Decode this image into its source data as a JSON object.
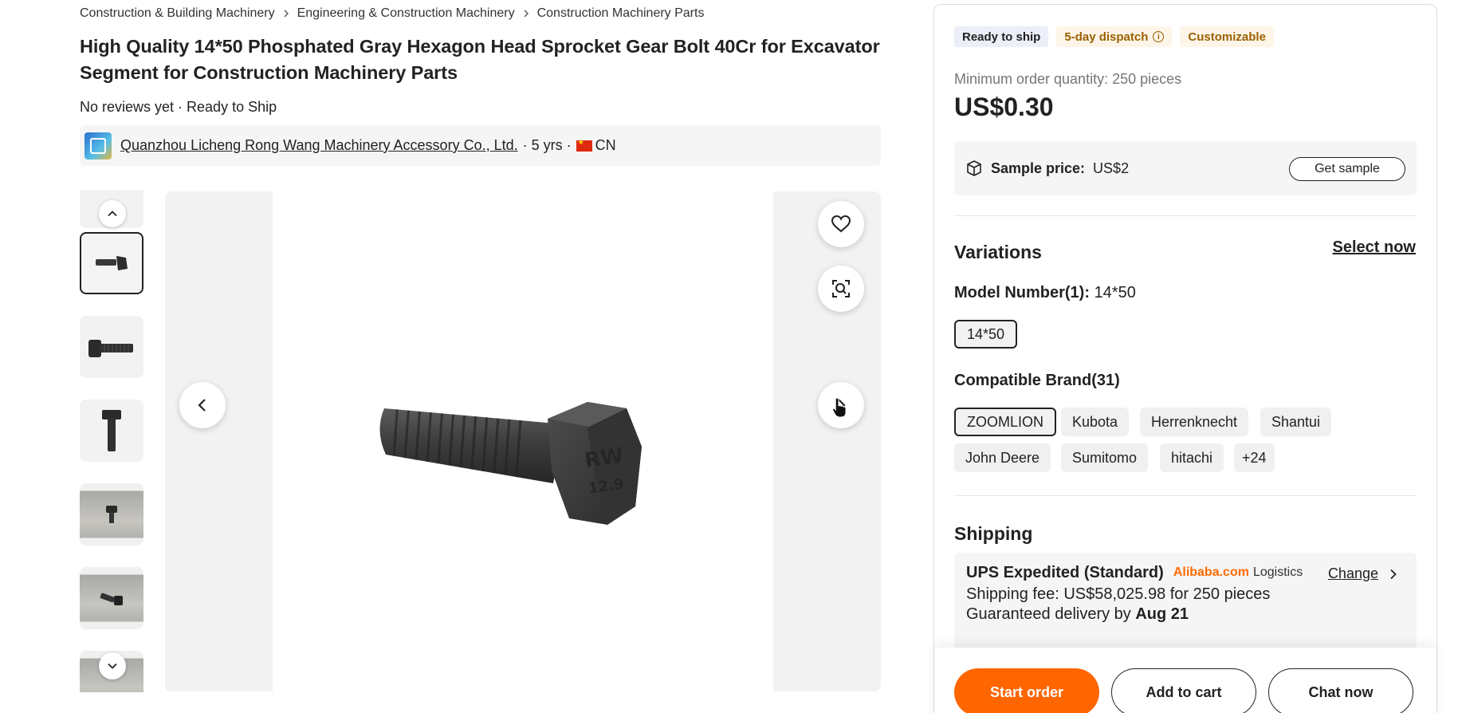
{
  "breadcrumb": [
    "Construction & Building Machinery",
    "Engineering & Construction Machinery",
    "Construction Machinery Parts"
  ],
  "product": {
    "title": "High Quality 14*50 Phosphated Gray Hexagon Head Sprocket Gear Bolt 40Cr for Excavator Segment for Construction Machinery Parts",
    "reviews_status": "No reviews yet · Ready to Ship"
  },
  "supplier": {
    "name": "Quanzhou Licheng Rong Wang Machinery Accessory Co., Ltd.",
    "years": "· 5 yrs ·",
    "country": "CN"
  },
  "gallery": {
    "thumbnail_count": 7,
    "active_index": 1
  },
  "badges": {
    "ready": "Ready to ship",
    "dispatch": "5-day dispatch",
    "dispatch_info": "i",
    "custom": "Customizable"
  },
  "pricing": {
    "moq": "Minimum order quantity: 250 pieces",
    "price": "US$0.30",
    "sample_label": "Sample price:",
    "sample_price": "US$2",
    "get_sample": "Get sample"
  },
  "variations": {
    "title": "Variations",
    "select_now": "Select now",
    "model_label": "Model Number(1):",
    "model_value": "14*50",
    "model_options": [
      "14*50"
    ],
    "brand_label": "Compatible Brand(31)",
    "brand_options": [
      "ZOOMLION",
      "Kubota",
      "Herrenknecht",
      "Shantui",
      "John Deere",
      "Sumitomo",
      "hitachi",
      "+24"
    ]
  },
  "shipping": {
    "title": "Shipping",
    "method": "UPS Expedited (Standard)",
    "logo_text": "Alibaba.com",
    "logistics": "Logistics",
    "change": "Change",
    "fee": "Shipping fee: US$58,025.98 for 250 pieces",
    "delivery_prefix": "Guaranteed delivery by",
    "delivery_date": "Aug 21"
  },
  "actions": {
    "start_order": "Start order",
    "add_to_cart": "Add to cart",
    "chat_now": "Chat now"
  },
  "colors": {
    "accent": "#ff6600",
    "badge_ready_bg": "#eceef8",
    "badge_warm_text": "#9b5f00"
  }
}
